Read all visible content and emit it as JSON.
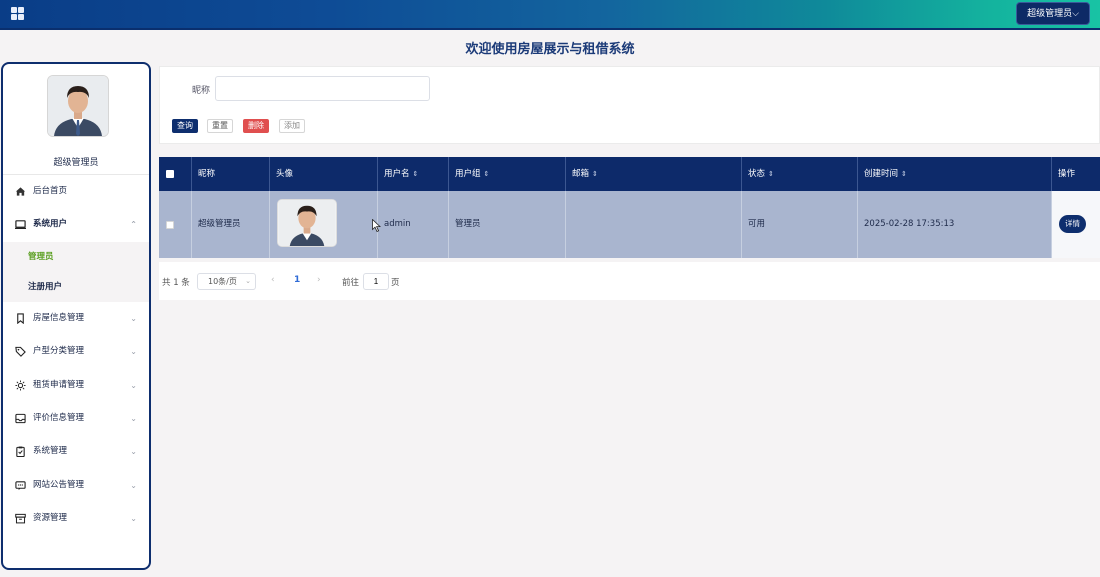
{
  "topbar": {
    "user_menu_label": "超级管理员⌵"
  },
  "page_title": "欢迎使用房屋展示与租借系统",
  "sidebar": {
    "admin_name": "超级管理员",
    "menu": [
      {
        "label": "后台首页",
        "icon": "home-icon"
      },
      {
        "label": "系统用户",
        "icon": "monitor-icon",
        "expanded": true
      },
      {
        "label": "房屋信息管理",
        "icon": "bookmark-icon"
      },
      {
        "label": "户型分类管理",
        "icon": "tag-icon"
      },
      {
        "label": "租赁申请管理",
        "icon": "sun-icon"
      },
      {
        "label": "评价信息管理",
        "icon": "inbox-icon"
      },
      {
        "label": "系统管理",
        "icon": "clipboard-icon"
      },
      {
        "label": "网站公告管理",
        "icon": "message-icon"
      },
      {
        "label": "资源管理",
        "icon": "archive-icon"
      }
    ],
    "submenu": [
      {
        "label": "管理员",
        "active": true
      },
      {
        "label": "注册用户",
        "active": false
      }
    ],
    "chevron_up": "⌃",
    "chevron_down": "⌄"
  },
  "search": {
    "nickname_label": "昵称",
    "nickname_value": "",
    "query_label": "查询",
    "reset_label": "重置",
    "delete_label": "删除",
    "add_label": "添加"
  },
  "table": {
    "headers": {
      "nickname": "昵称",
      "avatar": "头像",
      "username": "用户名",
      "usergroup": "用户组",
      "email": "邮箱",
      "status": "状态",
      "created": "创建时间",
      "operation": "操作"
    },
    "sort_symbol": "⇕",
    "rows": [
      {
        "nickname": "超级管理员",
        "username": "admin",
        "usergroup": "管理员",
        "email": "",
        "status": "可用",
        "created": "2025-02-28 17:35:13",
        "detail_label": "详情"
      }
    ]
  },
  "pager": {
    "total": "共 1 条",
    "page_size": "10条/页",
    "prev": "‹",
    "current_page": "1",
    "next": "›",
    "goto_label": "前往",
    "goto_value": "1",
    "page_unit": "页"
  },
  "colors": {
    "primary": "#0d2a6a",
    "row_selected": "#a9b5cf",
    "danger": "#e04f4f",
    "active_submenu": "#5da024"
  }
}
